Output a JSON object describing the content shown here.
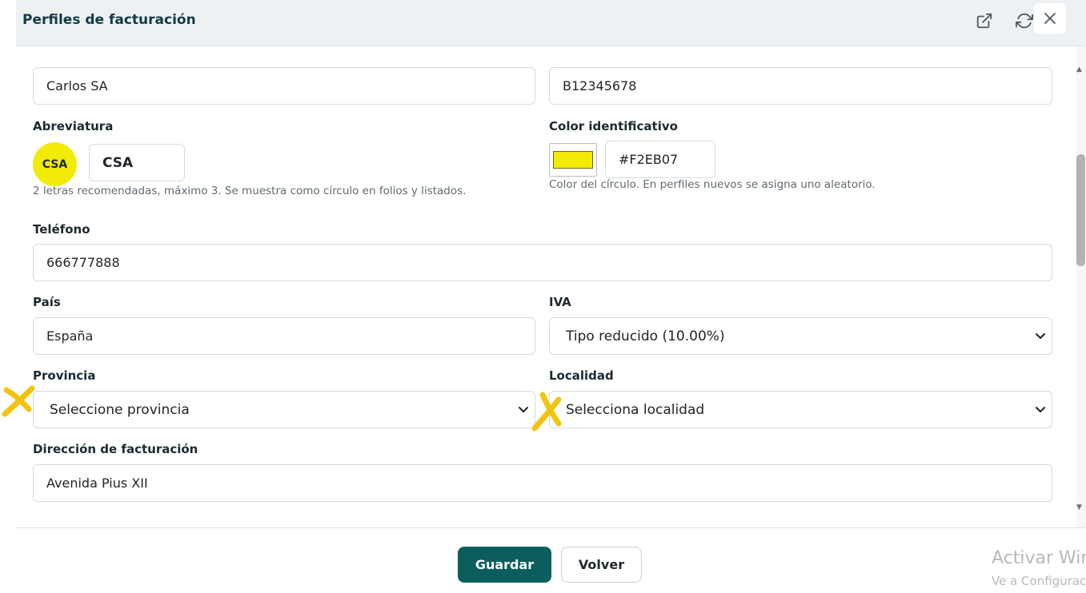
{
  "header": {
    "title": "Perfiles de facturación",
    "icons": [
      "external-link-icon",
      "refresh-icon",
      "close-icon"
    ]
  },
  "form": {
    "name_value": "Carlos SA",
    "nif_value": "B12345678",
    "abbreviation": {
      "label": "Abreviatura",
      "badge_text": "CSA",
      "value": "CSA",
      "help": "2 letras recomendadas, máximo 3. Se muestra como círculo en folios y listados."
    },
    "color": {
      "label": "Color identificativo",
      "swatch_color": "#F2EB07",
      "value": "#F2EB07",
      "help": "Color del círculo. En perfiles nuevos se asigna uno aleatorio."
    },
    "phone": {
      "label": "Teléfono",
      "value": "666777888"
    },
    "country": {
      "label": "País",
      "value": "España"
    },
    "vat": {
      "label": "IVA",
      "selected": "Tipo reducido (10.00%)"
    },
    "province": {
      "label": "Provincia",
      "selected": "Seleccione provincia"
    },
    "locality": {
      "label": "Localidad",
      "selected": "Selecciona localidad"
    },
    "billing_address": {
      "label": "Dirección de facturación",
      "value": "Avenida Pius XII"
    }
  },
  "footer": {
    "save_label": "Guardar",
    "back_label": "Volver"
  },
  "watermark": {
    "line1": "Activar Windows",
    "line2": "Ve a Configuración"
  },
  "colors": {
    "accent": "#0C5E5E",
    "badge": "#F2EB07",
    "annotation_mark": "#F2C40F"
  }
}
